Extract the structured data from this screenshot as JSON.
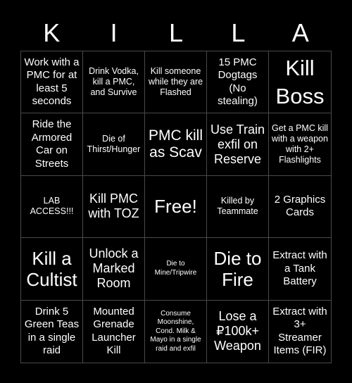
{
  "title_letters": [
    "K",
    "I",
    "L",
    "L",
    "A"
  ],
  "colors": {
    "background": "#000000",
    "text": "#ffffff",
    "grid_line": "#4a4a4a"
  },
  "cells": [
    "Work with a PMC for at least 5 seconds",
    "Drink Vodka, kill a PMC, and Survive",
    "Kill someone while they are Flashed",
    "15 PMC Dogtags (No stealing)",
    "Kill Boss",
    "Ride the Armored Car on Streets",
    "Die of Thirst/Hunger",
    "PMC kill as Scav",
    "Use Train exfil on Reserve",
    "Get a PMC kill with a weapon with 2+ Flashlights",
    "LAB ACCESS!!!",
    "Kill PMC with TOZ",
    "Free!",
    "Killed by Teammate",
    "2 Graphics Cards",
    "Kill a Cultist",
    "Unlock a Marked Room",
    "Die to Mine/Tripwire",
    "Die to Fire",
    "Extract with a Tank Battery",
    "Drink 5 Green Teas in a single raid",
    "Mounted Grenade Launcher Kill",
    "Consume Moonshine, Cond. Milk & Mayo in a single raid and exfil",
    "Lose a ₽100k+ Weapon",
    "Extract with 3+ Streamer Items (FIR)"
  ]
}
